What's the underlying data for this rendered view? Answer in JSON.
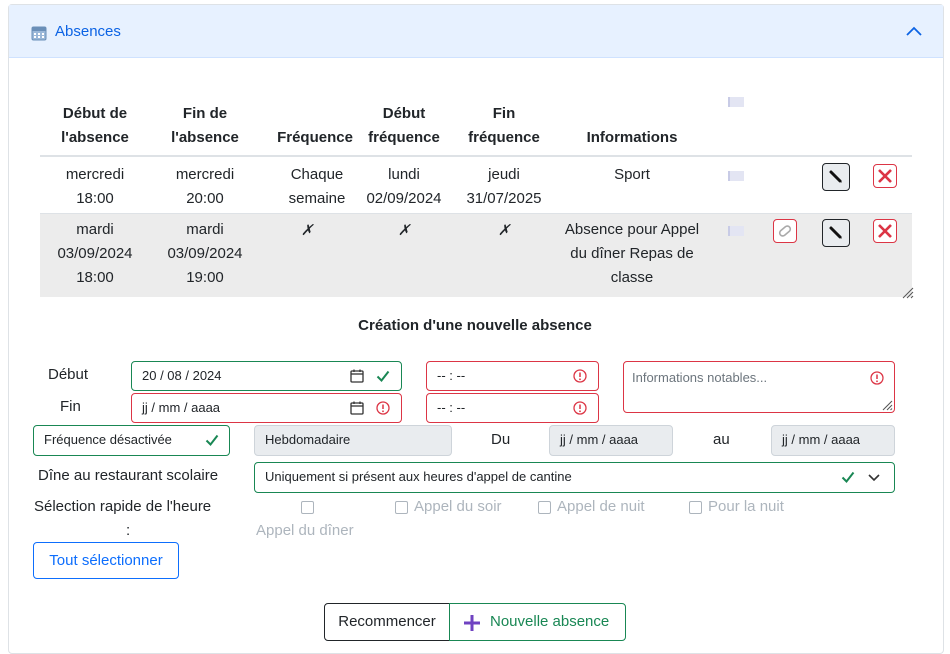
{
  "header": {
    "title": "Absences",
    "icon": "calendar-icon",
    "toggle_icon": "chevron-up-icon"
  },
  "table": {
    "columns": [
      "Début de\nl'absence",
      "Fin de\nl'absence",
      "Fréquence",
      "Début\nfréquence",
      "Fin\nfréquence",
      "Informations"
    ],
    "rows": [
      {
        "debut": [
          "mercredi",
          "18:00"
        ],
        "fin": [
          "mercredi",
          "20:00"
        ],
        "frequence": [
          "Chaque",
          "semaine"
        ],
        "debut_frequence": [
          "lundi",
          "02/09/2024"
        ],
        "fin_frequence": [
          "jeudi",
          "31/07/2025"
        ],
        "informations": [
          "Sport"
        ]
      },
      {
        "debut": [
          "mardi",
          "03/09/2024",
          "18:00"
        ],
        "fin": [
          "mardi",
          "03/09/2024",
          "19:00"
        ],
        "frequence": [
          "✗"
        ],
        "debut_frequence": [
          "✗"
        ],
        "fin_frequence": [
          "✗"
        ],
        "informations": [
          "Absence pour Appel",
          "du dîner Repas de",
          "classe"
        ]
      }
    ]
  },
  "form": {
    "title": "Création d'une nouvelle absence",
    "debut_label": "Début",
    "fin_label": "Fin",
    "debut_date": "20 / 08 / 2024",
    "fin_date_placeholder": "jj / mm / aaaa",
    "time_placeholder": "-- : --",
    "info_placeholder": "Informations notables...",
    "frequence_value": "Fréquence désactivée",
    "frequence_type": "Hebdomadaire",
    "du_label": "Du",
    "au_label": "au",
    "date_placeholder": "jj / mm / aaaa",
    "cantine_label": "Dîne au restaurant scolaire",
    "cantine_value": "Uniquement si présent aux heures d'appel de cantine",
    "quick_label_1": "Sélection rapide de l'heure",
    "quick_label_2": ":",
    "quick_options": [
      "Appel du dîner",
      "Appel du soir",
      "Appel de nuit",
      "Pour la nuit"
    ],
    "select_all": "Tout sélectionner",
    "reset": "Recommencer",
    "new_absence": "Nouvelle absence"
  },
  "colors": {
    "accent": "#0c63e4",
    "danger": "#dc3545",
    "success": "#198754",
    "header_bg": "#e7f1ff"
  }
}
